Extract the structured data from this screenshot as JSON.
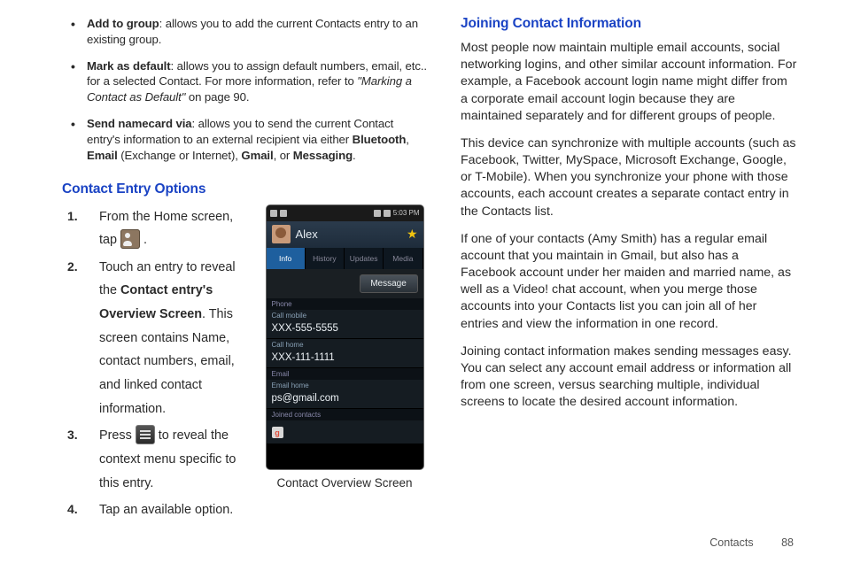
{
  "leftColumn": {
    "bullets": [
      {
        "label": "Add to group",
        "text": ": allows you to add the current Contacts entry to an existing group."
      },
      {
        "label": "Mark as default",
        "text": ": allows you to assign default numbers, email, etc.. for a selected Contact. For more information, refer to ",
        "refItalic": "\"Marking a Contact as Default\"",
        "refTail": "  on page 90."
      },
      {
        "label": "Send namecard via",
        "text": ": allows you to send the current Contact entry's information to an external recipient via either ",
        "b1": "Bluetooth",
        "j1": ", ",
        "b2": "Email",
        "j2": " (Exchange or Internet), ",
        "b3": "Gmail",
        "j3": ", or ",
        "b4": "Messaging",
        "j4": "."
      }
    ],
    "sectionTitle": "Contact Entry Options",
    "steps": {
      "s1a": "From the Home screen, tap ",
      "s1b": " .",
      "s2a": "Touch an entry to reveal the ",
      "s2bold": "Contact entry's Overview Screen",
      "s2b": ". This screen contains Name, contact numbers, email, and linked contact information.",
      "s3a": "Press ",
      "s3b": " to reveal the context menu specific to this entry.",
      "s4": "Tap an available option."
    },
    "phone": {
      "time": "5:03 PM",
      "name": "Alex",
      "tabs": {
        "info": "Info",
        "history": "History",
        "updates": "Updates",
        "media": "Media"
      },
      "messageBtn": "Message",
      "sectPhone": "Phone",
      "callMobile": "Call mobile",
      "mobile": "XXX-555-5555",
      "callHome": "Call home",
      "home": "XXX-111-1111",
      "sectEmail": "Email",
      "emailHome": "Email home",
      "email": "ps@gmail.com",
      "joined": "Joined contacts",
      "gLetter": "g"
    },
    "phoneCaption": "Contact Overview Screen"
  },
  "rightColumn": {
    "sectionTitle": "Joining Contact Information",
    "paras": [
      "Most people now maintain multiple email accounts, social networking logins, and other similar account information. For example, a Facebook account login name might differ from a corporate email account login because they are maintained separately and for different groups of people.",
      "This device can synchronize with multiple accounts (such as Facebook, Twitter, MySpace, Microsoft Exchange, Google, or T-Mobile). When you synchronize your phone with those accounts, each account creates a separate contact entry in the Contacts list.",
      "If one of your contacts (Amy Smith) has a regular email account that you maintain in Gmail, but also has a Facebook account under her maiden and married name, as well as a Video! chat account, when you merge those accounts into your Contacts list you can join all of her entries and view the information in one record.",
      "Joining contact information makes sending messages easy. You can select any account email address or information all from one screen, versus searching multiple, individual screens to locate the desired account information."
    ]
  },
  "footer": {
    "section": "Contacts",
    "page": "88"
  }
}
